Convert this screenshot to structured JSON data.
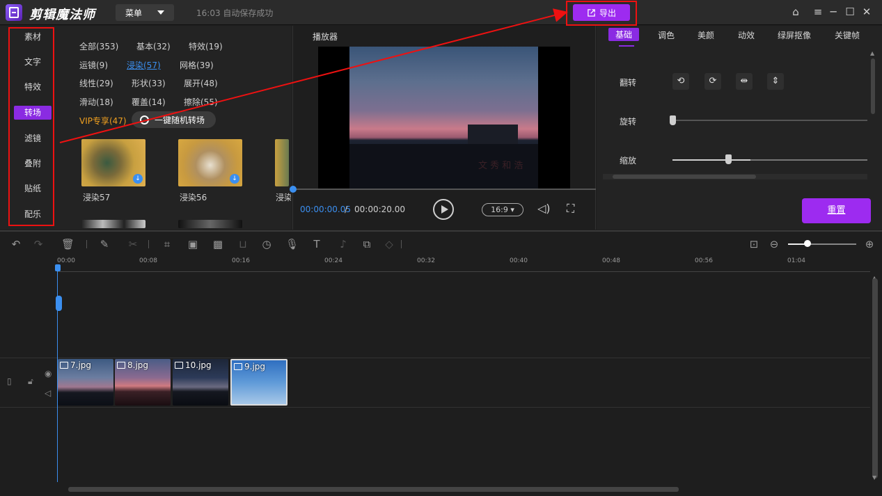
{
  "app": {
    "title": "剪辑魔法师",
    "menu_label": "菜单",
    "autosave": "16:03 自动保存成功",
    "export_label": "导出"
  },
  "nav": {
    "items": [
      "素材",
      "文字",
      "特效",
      "转场",
      "滤镜",
      "叠附",
      "贴纸",
      "配乐"
    ],
    "active": "转场"
  },
  "library": {
    "categories": [
      {
        "label": "全部(353)"
      },
      {
        "label": "基本(32)"
      },
      {
        "label": "特效(19)"
      },
      {
        "label": "运镜(9)"
      },
      {
        "label": "浸染(57)"
      },
      {
        "label": "网格(39)"
      },
      {
        "label": "线性(29)"
      },
      {
        "label": "形状(33)"
      },
      {
        "label": "展开(48)"
      },
      {
        "label": "滑动(18)"
      },
      {
        "label": "覆盖(14)"
      },
      {
        "label": "擦除(55)"
      },
      {
        "label": "VIP专享(47)"
      }
    ],
    "random_btn": "一键随机转场",
    "items": [
      {
        "label": "浸染57"
      },
      {
        "label": "浸染56"
      },
      {
        "label": "浸染"
      }
    ]
  },
  "player": {
    "title": "播放器",
    "time_current": "00:00:00.05",
    "time_sep": " / ",
    "time_total": "00:00:20.00",
    "ratio": "16:9 ▾",
    "watermark": "文 秀 和 浩"
  },
  "props": {
    "tabs": [
      "基础",
      "调色",
      "美颜",
      "动效",
      "绿屏抠像",
      "关键帧"
    ],
    "active_tab": "基础",
    "labels": {
      "flip": "翻转",
      "rotate": "旋转",
      "scale": "缩放"
    },
    "rotate_level": 0,
    "scale_level": 0.4,
    "reset_label": "重置"
  },
  "timeline": {
    "ticks": [
      "00:00",
      "00:08",
      "00:16",
      "00:24",
      "00:32",
      "00:40",
      "00:48",
      "00:56",
      "01:04"
    ],
    "clips": [
      {
        "name": "7.jpg"
      },
      {
        "name": "8.jpg"
      },
      {
        "name": "10.jpg"
      },
      {
        "name": "9.jpg"
      }
    ]
  },
  "colors": {
    "accent": "#9d2bf0",
    "highlight_box": "#e11111",
    "link": "#3b8ff0"
  }
}
